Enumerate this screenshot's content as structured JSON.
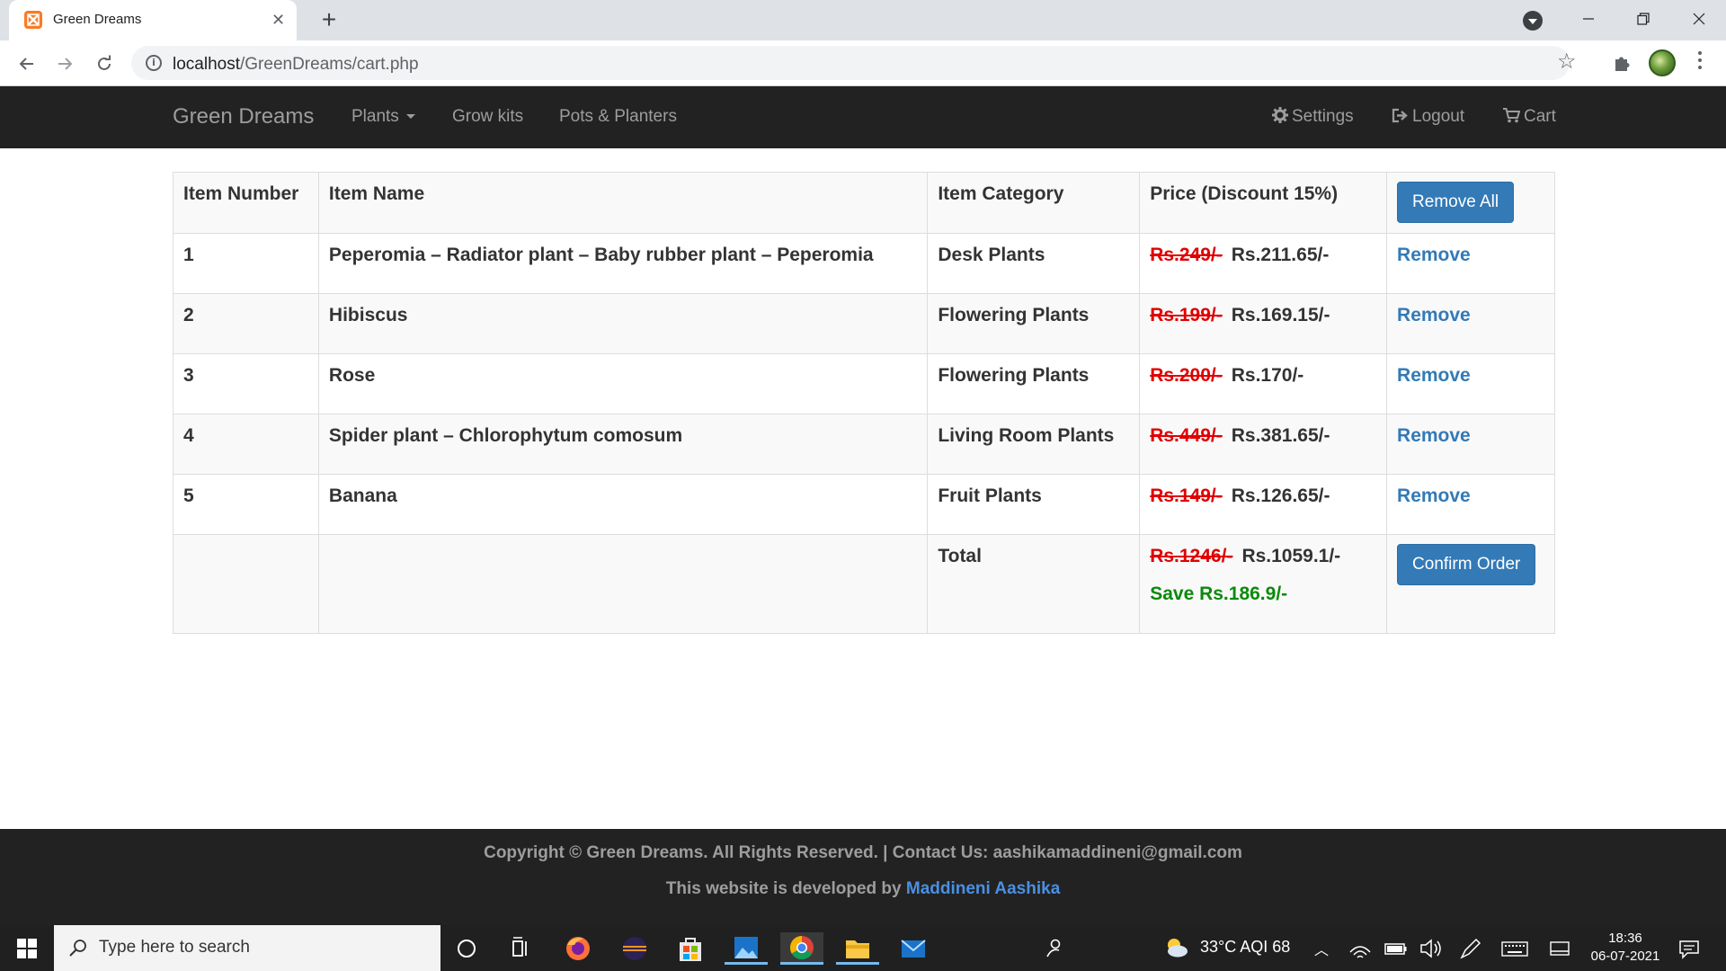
{
  "browser": {
    "tab_title": "Green Dreams",
    "tab_close": "✕",
    "new_tab": "+",
    "url_host": "localhost",
    "url_path": "/GreenDreams/cart.php"
  },
  "navbar": {
    "brand": "Green Dreams",
    "plants": "Plants",
    "grow_kits": "Grow kits",
    "pots": "Pots & Planters",
    "settings": "Settings",
    "logout": "Logout",
    "cart": "Cart"
  },
  "table": {
    "headers": {
      "item_number": "Item Number",
      "item_name": "Item Name",
      "item_category": "Item Category",
      "price": "Price (Discount 15%)",
      "remove_all": "Remove All"
    },
    "rows": [
      {
        "num": "1",
        "name": "Peperomia – Radiator plant – Baby rubber plant – Peperomia",
        "category": "Desk Plants",
        "old_price": "Rs.249/-",
        "new_price": "Rs.211.65/-",
        "action": "Remove"
      },
      {
        "num": "2",
        "name": "Hibiscus",
        "category": "Flowering Plants",
        "old_price": "Rs.199/-",
        "new_price": "Rs.169.15/-",
        "action": "Remove"
      },
      {
        "num": "3",
        "name": "Rose",
        "category": "Flowering Plants",
        "old_price": "Rs.200/-",
        "new_price": "Rs.170/-",
        "action": "Remove"
      },
      {
        "num": "4",
        "name": "Spider plant – Chlorophytum comosum",
        "category": "Living Room Plants",
        "old_price": "Rs.449/-",
        "new_price": "Rs.381.65/-",
        "action": "Remove"
      },
      {
        "num": "5",
        "name": "Banana",
        "category": "Fruit Plants",
        "old_price": "Rs.149/-",
        "new_price": "Rs.126.65/-",
        "action": "Remove"
      }
    ],
    "total": {
      "label": "Total",
      "old_price": "Rs.1246/-",
      "new_price": "Rs.1059.1/-",
      "save": "Save Rs.186.9/-",
      "confirm": "Confirm Order"
    }
  },
  "footer": {
    "line1": "Copyright © Green Dreams. All Rights Reserved. | Contact Us: aashikamaddineni@gmail.com",
    "line2_prefix": "This website is developed by ",
    "developer": "Maddineni Aashika"
  },
  "taskbar": {
    "search_placeholder": "Type here to search",
    "weather": "33°C  AQI 68",
    "time": "18:36",
    "date": "06-07-2021"
  },
  "colors": {
    "navbar_bg": "#222222",
    "primary": "#337ab7",
    "strike_red": "#e00000",
    "save_green": "#0a8a0a"
  }
}
